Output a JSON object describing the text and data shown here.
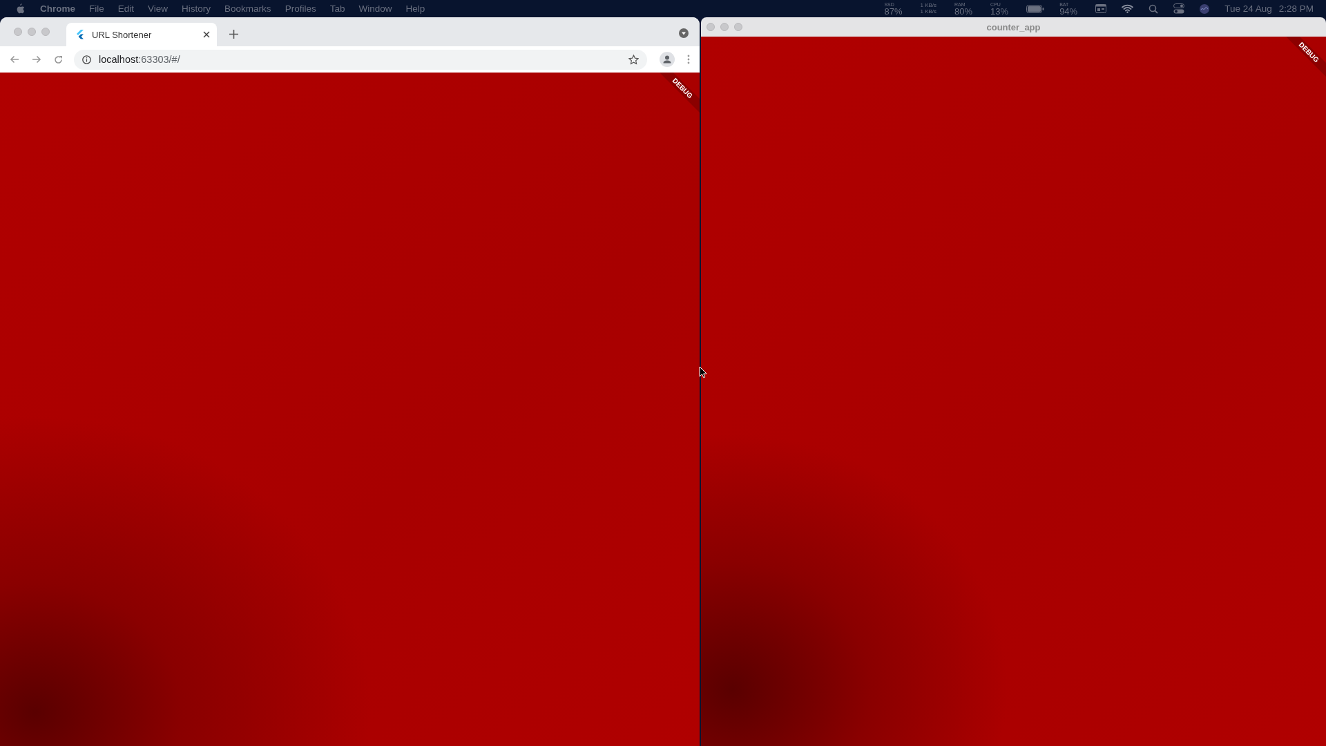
{
  "menu_bar": {
    "app": "Chrome",
    "menus": [
      "File",
      "Edit",
      "View",
      "History",
      "Bookmarks",
      "Profiles",
      "Tab",
      "Window",
      "Help"
    ],
    "status_items": [
      {
        "kind": "stat",
        "label": "SSD",
        "value": "87%"
      },
      {
        "kind": "rates",
        "lines": [
          "1 KB/s",
          "1 KB/s"
        ]
      },
      {
        "kind": "stat",
        "label": "RAM",
        "value": "80%"
      },
      {
        "kind": "stat",
        "label": "CPU",
        "value": "13%"
      },
      {
        "kind": "battery"
      },
      {
        "kind": "stat",
        "label": "BAT",
        "value": "94%"
      },
      {
        "kind": "calendar"
      },
      {
        "kind": "wifi"
      },
      {
        "kind": "search"
      },
      {
        "kind": "control"
      },
      {
        "kind": "siri"
      }
    ],
    "date": "Tue 24 Aug",
    "time": "2:28 PM"
  },
  "browser": {
    "tabs": [
      {
        "title": "URL Shortener",
        "selected": true
      }
    ],
    "url_host": "localhost",
    "url_path": ":63303/#/",
    "banner": "DEBUG"
  },
  "app_window": {
    "title": "counter_app",
    "banner": "DEBUG"
  }
}
